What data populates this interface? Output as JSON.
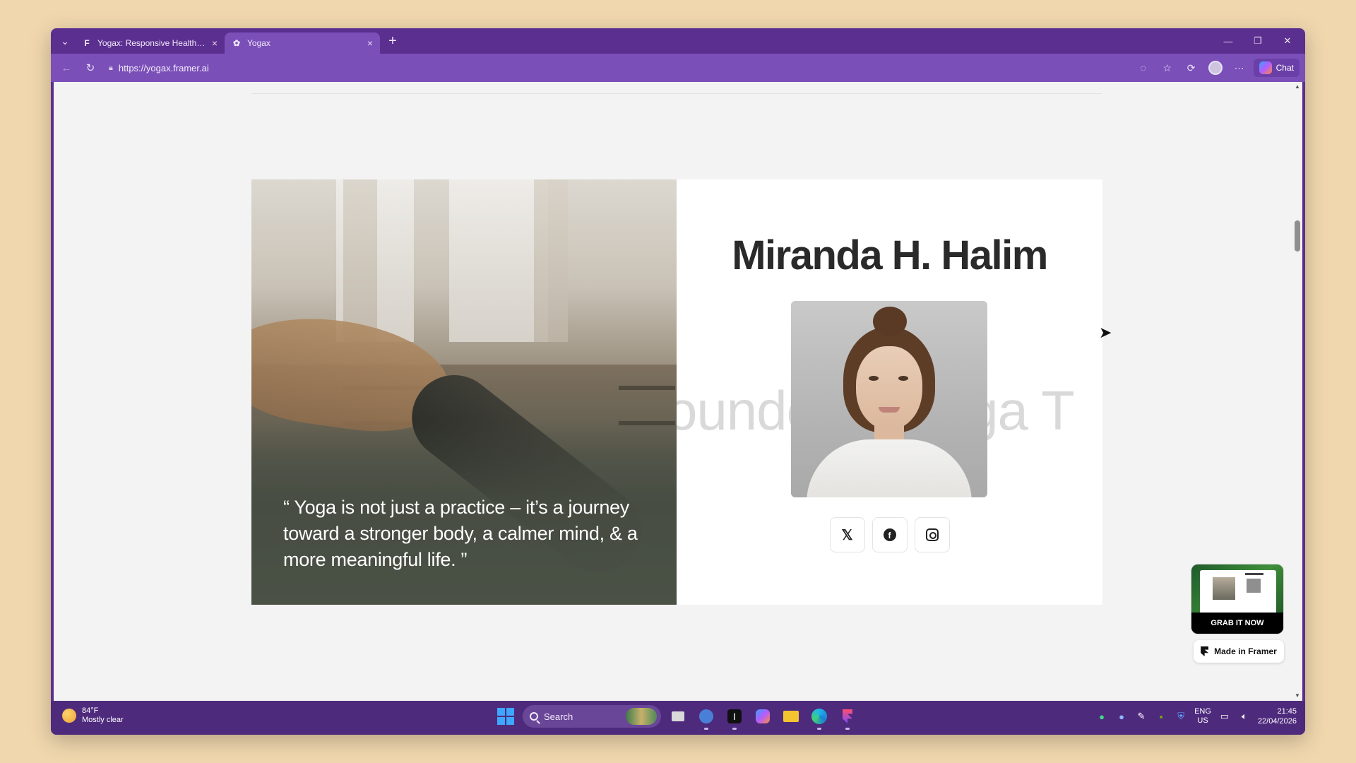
{
  "browser": {
    "tabs": [
      {
        "label": "Yogax: Responsive Health Website",
        "active": false
      },
      {
        "label": "Yogax",
        "active": true
      }
    ],
    "url": "https://yogax.framer.ai",
    "chat_label": "Chat"
  },
  "page": {
    "quote": "“ Yoga is not just a practice – it’s a journey toward a stronger body, a calmer mind, & a more meaningful life. ”",
    "name": "Miranda H. Halim",
    "marquee_text": "ounder of Yoga T",
    "socials": [
      "x-icon",
      "facebook-icon",
      "instagram-icon"
    ]
  },
  "framer_widget": {
    "grab_label": "GRAB IT NOW",
    "made_in": "Made in Framer"
  },
  "taskbar": {
    "weather_temp": "84°F",
    "weather_desc": "Mostly clear",
    "search_label": "Search",
    "lang_top": "ENG",
    "lang_bottom": "US",
    "time": "21:45",
    "date": "22/04/2026"
  },
  "colors": {
    "browser_frame": "#5b2f8f",
    "address_bar": "#7a4fb8",
    "taskbar": "#4e2a7d",
    "page_bg": "#f3f3f3",
    "desktop": "#f0d7ae"
  }
}
